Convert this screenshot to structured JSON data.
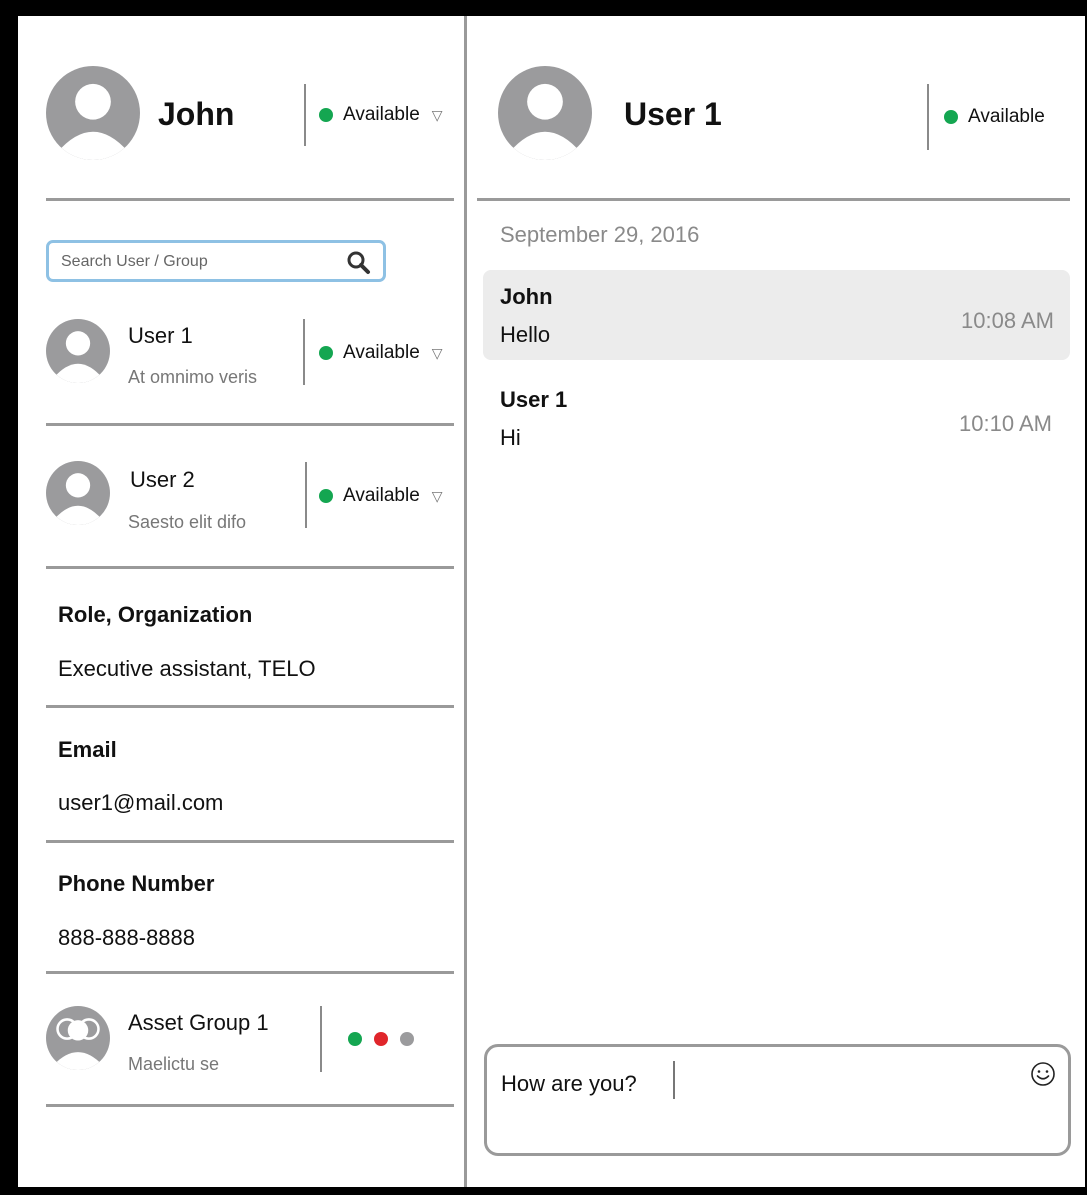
{
  "current_user": {
    "name": "John",
    "status": "Available",
    "status_color": "#14a651"
  },
  "search": {
    "placeholder": "Search User / Group"
  },
  "contacts": [
    {
      "name": "User 1",
      "subtitle": "At omnimo veris",
      "status": "Available"
    },
    {
      "name": "User 2",
      "subtitle": "Saesto elit difo",
      "status": "Available"
    }
  ],
  "profile": {
    "role_label": "Role, Organization",
    "role_value": "Executive assistant, TELO",
    "email_label": "Email",
    "email_value": "user1@mail.com",
    "phone_label": "Phone Number",
    "phone_value": "888-888-8888"
  },
  "group": {
    "name": "Asset Group 1",
    "subtitle": "Maelictu se",
    "status_colors": [
      "#14a651",
      "#e0262b",
      "#9b9b9d"
    ]
  },
  "chat": {
    "partner_name": "User 1",
    "partner_status": "Available",
    "date": "September 29, 2016",
    "messages": [
      {
        "sender": "John",
        "text": "Hello",
        "time": "10:08 AM",
        "highlighted": true
      },
      {
        "sender": "User 1",
        "text": "Hi",
        "time": "10:10 AM",
        "highlighted": false
      }
    ],
    "composer_value": "How are you?"
  },
  "icons": {
    "avatar": "person-avatar-icon",
    "group_avatar": "group-avatar-icon",
    "search": "search-icon",
    "emoji": "smiley-icon",
    "dropdown": "triangle-down-icon"
  }
}
